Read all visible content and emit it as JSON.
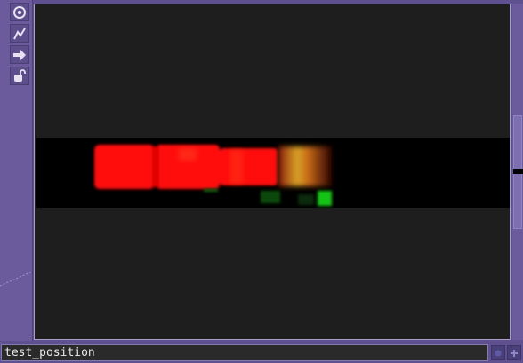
{
  "toolbar": {
    "items": [
      {
        "icon": "viewer-target-icon"
      },
      {
        "icon": "graph-line-icon"
      },
      {
        "icon": "arrow-right-icon"
      },
      {
        "icon": "lock-open-icon"
      }
    ]
  },
  "viewer": {
    "node_name": "test_position"
  },
  "colors": {
    "panel": "#6b5b9d",
    "viewer_bg": "#1e1e1e",
    "red": "#ff0a0a",
    "green": "#13b813"
  }
}
